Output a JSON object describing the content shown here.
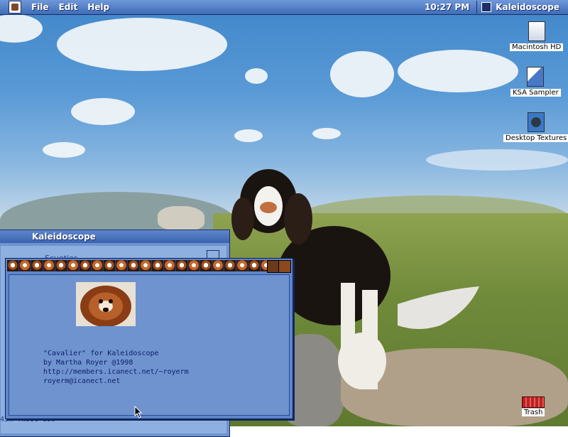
{
  "menubar": {
    "menus": [
      "File",
      "Edit",
      "Help"
    ],
    "clock": "10:27 PM",
    "active_app": "Kaleidoscope"
  },
  "desktop_icons": [
    {
      "label": "Macintosh HD",
      "icon": "hard-disk-icon"
    },
    {
      "label": "KSA Sampler",
      "icon": "folder-pen-icon"
    },
    {
      "label": "Desktop Textures",
      "icon": "picture-folder-icon"
    },
    {
      "label": "Trash",
      "icon": "trash-icon"
    }
  ],
  "back_window": {
    "title": "Kaleidoscope",
    "partial_label": "Scueties",
    "registration": "45K-YW98C-359"
  },
  "about_window": {
    "credits": [
      "\"Cavalier\" for Kaleidoscope",
      "by  Martha Royer @1998",
      "http://members.icanect.net/~royerm",
      "royerm@icanect.net"
    ]
  },
  "colors": {
    "menubar": "#3f6cb8",
    "window_frame": "#5f86c9",
    "credit_text": "#0d1d6a"
  }
}
